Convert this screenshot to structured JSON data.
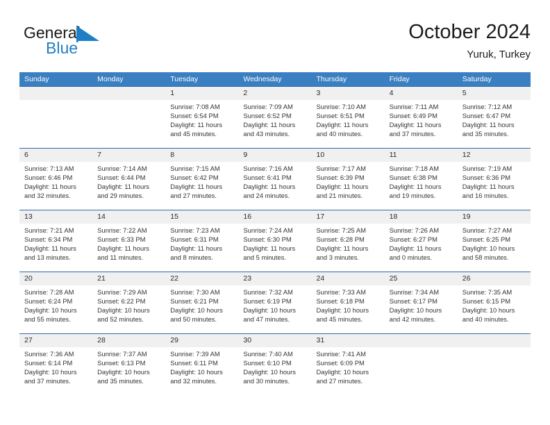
{
  "brand": {
    "name_part1": "General",
    "name_part2": "Blue",
    "flag_icon": "blue-triangle-flag",
    "accent_color": "#1f7fc4"
  },
  "header": {
    "month_title": "October 2024",
    "location": "Yuruk, Turkey"
  },
  "theme": {
    "header_bar_color": "#3a7fc1",
    "row_divider_color": "#2f6ba6",
    "date_band_color": "#f0f0f0",
    "text_color": "#333333"
  },
  "weekdays": [
    "Sunday",
    "Monday",
    "Tuesday",
    "Wednesday",
    "Thursday",
    "Friday",
    "Saturday"
  ],
  "weeks": [
    {
      "days": [
        {
          "num": "",
          "sunrise": "",
          "sunset": "",
          "daylight_line1": "",
          "daylight_line2": ""
        },
        {
          "num": "",
          "sunrise": "",
          "sunset": "",
          "daylight_line1": "",
          "daylight_line2": ""
        },
        {
          "num": "1",
          "sunrise": "Sunrise: 7:08 AM",
          "sunset": "Sunset: 6:54 PM",
          "daylight_line1": "Daylight: 11 hours",
          "daylight_line2": "and 45 minutes."
        },
        {
          "num": "2",
          "sunrise": "Sunrise: 7:09 AM",
          "sunset": "Sunset: 6:52 PM",
          "daylight_line1": "Daylight: 11 hours",
          "daylight_line2": "and 43 minutes."
        },
        {
          "num": "3",
          "sunrise": "Sunrise: 7:10 AM",
          "sunset": "Sunset: 6:51 PM",
          "daylight_line1": "Daylight: 11 hours",
          "daylight_line2": "and 40 minutes."
        },
        {
          "num": "4",
          "sunrise": "Sunrise: 7:11 AM",
          "sunset": "Sunset: 6:49 PM",
          "daylight_line1": "Daylight: 11 hours",
          "daylight_line2": "and 37 minutes."
        },
        {
          "num": "5",
          "sunrise": "Sunrise: 7:12 AM",
          "sunset": "Sunset: 6:47 PM",
          "daylight_line1": "Daylight: 11 hours",
          "daylight_line2": "and 35 minutes."
        }
      ]
    },
    {
      "days": [
        {
          "num": "6",
          "sunrise": "Sunrise: 7:13 AM",
          "sunset": "Sunset: 6:46 PM",
          "daylight_line1": "Daylight: 11 hours",
          "daylight_line2": "and 32 minutes."
        },
        {
          "num": "7",
          "sunrise": "Sunrise: 7:14 AM",
          "sunset": "Sunset: 6:44 PM",
          "daylight_line1": "Daylight: 11 hours",
          "daylight_line2": "and 29 minutes."
        },
        {
          "num": "8",
          "sunrise": "Sunrise: 7:15 AM",
          "sunset": "Sunset: 6:42 PM",
          "daylight_line1": "Daylight: 11 hours",
          "daylight_line2": "and 27 minutes."
        },
        {
          "num": "9",
          "sunrise": "Sunrise: 7:16 AM",
          "sunset": "Sunset: 6:41 PM",
          "daylight_line1": "Daylight: 11 hours",
          "daylight_line2": "and 24 minutes."
        },
        {
          "num": "10",
          "sunrise": "Sunrise: 7:17 AM",
          "sunset": "Sunset: 6:39 PM",
          "daylight_line1": "Daylight: 11 hours",
          "daylight_line2": "and 21 minutes."
        },
        {
          "num": "11",
          "sunrise": "Sunrise: 7:18 AM",
          "sunset": "Sunset: 6:38 PM",
          "daylight_line1": "Daylight: 11 hours",
          "daylight_line2": "and 19 minutes."
        },
        {
          "num": "12",
          "sunrise": "Sunrise: 7:19 AM",
          "sunset": "Sunset: 6:36 PM",
          "daylight_line1": "Daylight: 11 hours",
          "daylight_line2": "and 16 minutes."
        }
      ]
    },
    {
      "days": [
        {
          "num": "13",
          "sunrise": "Sunrise: 7:21 AM",
          "sunset": "Sunset: 6:34 PM",
          "daylight_line1": "Daylight: 11 hours",
          "daylight_line2": "and 13 minutes."
        },
        {
          "num": "14",
          "sunrise": "Sunrise: 7:22 AM",
          "sunset": "Sunset: 6:33 PM",
          "daylight_line1": "Daylight: 11 hours",
          "daylight_line2": "and 11 minutes."
        },
        {
          "num": "15",
          "sunrise": "Sunrise: 7:23 AM",
          "sunset": "Sunset: 6:31 PM",
          "daylight_line1": "Daylight: 11 hours",
          "daylight_line2": "and 8 minutes."
        },
        {
          "num": "16",
          "sunrise": "Sunrise: 7:24 AM",
          "sunset": "Sunset: 6:30 PM",
          "daylight_line1": "Daylight: 11 hours",
          "daylight_line2": "and 5 minutes."
        },
        {
          "num": "17",
          "sunrise": "Sunrise: 7:25 AM",
          "sunset": "Sunset: 6:28 PM",
          "daylight_line1": "Daylight: 11 hours",
          "daylight_line2": "and 3 minutes."
        },
        {
          "num": "18",
          "sunrise": "Sunrise: 7:26 AM",
          "sunset": "Sunset: 6:27 PM",
          "daylight_line1": "Daylight: 11 hours",
          "daylight_line2": "and 0 minutes."
        },
        {
          "num": "19",
          "sunrise": "Sunrise: 7:27 AM",
          "sunset": "Sunset: 6:25 PM",
          "daylight_line1": "Daylight: 10 hours",
          "daylight_line2": "and 58 minutes."
        }
      ]
    },
    {
      "days": [
        {
          "num": "20",
          "sunrise": "Sunrise: 7:28 AM",
          "sunset": "Sunset: 6:24 PM",
          "daylight_line1": "Daylight: 10 hours",
          "daylight_line2": "and 55 minutes."
        },
        {
          "num": "21",
          "sunrise": "Sunrise: 7:29 AM",
          "sunset": "Sunset: 6:22 PM",
          "daylight_line1": "Daylight: 10 hours",
          "daylight_line2": "and 52 minutes."
        },
        {
          "num": "22",
          "sunrise": "Sunrise: 7:30 AM",
          "sunset": "Sunset: 6:21 PM",
          "daylight_line1": "Daylight: 10 hours",
          "daylight_line2": "and 50 minutes."
        },
        {
          "num": "23",
          "sunrise": "Sunrise: 7:32 AM",
          "sunset": "Sunset: 6:19 PM",
          "daylight_line1": "Daylight: 10 hours",
          "daylight_line2": "and 47 minutes."
        },
        {
          "num": "24",
          "sunrise": "Sunrise: 7:33 AM",
          "sunset": "Sunset: 6:18 PM",
          "daylight_line1": "Daylight: 10 hours",
          "daylight_line2": "and 45 minutes."
        },
        {
          "num": "25",
          "sunrise": "Sunrise: 7:34 AM",
          "sunset": "Sunset: 6:17 PM",
          "daylight_line1": "Daylight: 10 hours",
          "daylight_line2": "and 42 minutes."
        },
        {
          "num": "26",
          "sunrise": "Sunrise: 7:35 AM",
          "sunset": "Sunset: 6:15 PM",
          "daylight_line1": "Daylight: 10 hours",
          "daylight_line2": "and 40 minutes."
        }
      ]
    },
    {
      "days": [
        {
          "num": "27",
          "sunrise": "Sunrise: 7:36 AM",
          "sunset": "Sunset: 6:14 PM",
          "daylight_line1": "Daylight: 10 hours",
          "daylight_line2": "and 37 minutes."
        },
        {
          "num": "28",
          "sunrise": "Sunrise: 7:37 AM",
          "sunset": "Sunset: 6:13 PM",
          "daylight_line1": "Daylight: 10 hours",
          "daylight_line2": "and 35 minutes."
        },
        {
          "num": "29",
          "sunrise": "Sunrise: 7:39 AM",
          "sunset": "Sunset: 6:11 PM",
          "daylight_line1": "Daylight: 10 hours",
          "daylight_line2": "and 32 minutes."
        },
        {
          "num": "30",
          "sunrise": "Sunrise: 7:40 AM",
          "sunset": "Sunset: 6:10 PM",
          "daylight_line1": "Daylight: 10 hours",
          "daylight_line2": "and 30 minutes."
        },
        {
          "num": "31",
          "sunrise": "Sunrise: 7:41 AM",
          "sunset": "Sunset: 6:09 PM",
          "daylight_line1": "Daylight: 10 hours",
          "daylight_line2": "and 27 minutes."
        },
        {
          "num": "",
          "sunrise": "",
          "sunset": "",
          "daylight_line1": "",
          "daylight_line2": ""
        },
        {
          "num": "",
          "sunrise": "",
          "sunset": "",
          "daylight_line1": "",
          "daylight_line2": ""
        }
      ]
    }
  ]
}
